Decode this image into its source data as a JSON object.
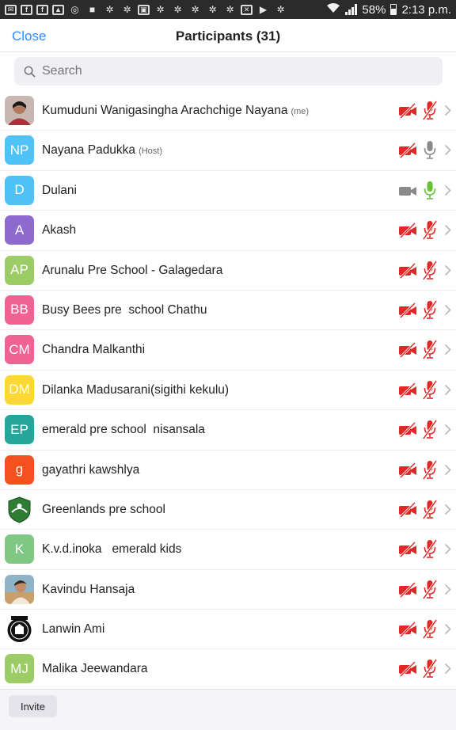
{
  "status_bar": {
    "battery": "58%",
    "time": "2:13 p.m."
  },
  "header": {
    "close_label": "Close",
    "title": "Participants (31)"
  },
  "search": {
    "placeholder": "Search"
  },
  "participants": [
    {
      "name": "Kumuduni Wanigasingha Arachchige Nayana",
      "tag": "(me)",
      "initials": "",
      "avatar_color": "#9b4d4d",
      "avatar_type": "photo",
      "video": "off",
      "audio": "muted"
    },
    {
      "name": "Nayana Padukka",
      "tag": "(Host)",
      "initials": "NP",
      "avatar_color": "#4fc3f7",
      "avatar_type": "initials",
      "video": "off",
      "audio": "available"
    },
    {
      "name": "Dulani",
      "tag": "",
      "initials": "D",
      "avatar_color": "#4fc3f7",
      "avatar_type": "initials",
      "video": "none",
      "audio": "on"
    },
    {
      "name": "Akash",
      "tag": "",
      "initials": "A",
      "avatar_color": "#8e6acf",
      "avatar_type": "initials",
      "video": "off",
      "audio": "muted"
    },
    {
      "name": "Arunalu Pre School - Galagedara",
      "tag": "",
      "initials": "AP",
      "avatar_color": "#9ccc65",
      "avatar_type": "initials",
      "video": "off",
      "audio": "muted"
    },
    {
      "name": "Busy Bees pre  school Chathu",
      "tag": "",
      "initials": "BB",
      "avatar_color": "#f06292",
      "avatar_type": "initials",
      "video": "off",
      "audio": "muted"
    },
    {
      "name": "Chandra Malkanthi",
      "tag": "",
      "initials": "CM",
      "avatar_color": "#f06292",
      "avatar_type": "initials",
      "video": "off",
      "audio": "muted"
    },
    {
      "name": "Dilanka Madusarani(sigithi kekulu)",
      "tag": "",
      "initials": "DM",
      "avatar_color": "#fdd835",
      "avatar_type": "initials",
      "video": "off",
      "audio": "muted"
    },
    {
      "name": "emerald pre school  nisansala",
      "tag": "",
      "initials": "EP",
      "avatar_color": "#26a69a",
      "avatar_type": "initials",
      "video": "off",
      "audio": "muted"
    },
    {
      "name": "gayathri kawshlya",
      "tag": "",
      "initials": "g",
      "avatar_color": "#f4511e",
      "avatar_type": "initials",
      "video": "off",
      "audio": "muted"
    },
    {
      "name": "Greenlands pre school",
      "tag": "",
      "initials": "",
      "avatar_color": "#2e7d32",
      "avatar_type": "logo-green",
      "video": "off",
      "audio": "muted"
    },
    {
      "name": "K.v.d.inoka   emerald kids",
      "tag": "",
      "initials": "K",
      "avatar_color": "#81c784",
      "avatar_type": "initials",
      "video": "off",
      "audio": "muted"
    },
    {
      "name": "Kavindu Hansaja",
      "tag": "",
      "initials": "",
      "avatar_color": "#b08d6a",
      "avatar_type": "photo2",
      "video": "off",
      "audio": "muted"
    },
    {
      "name": "Lanwin Ami",
      "tag": "",
      "initials": "",
      "avatar_color": "#111111",
      "avatar_type": "logo-dark",
      "video": "off",
      "audio": "muted"
    },
    {
      "name": "Malika Jeewandara",
      "tag": "",
      "initials": "MJ",
      "avatar_color": "#9ccc65",
      "avatar_type": "initials",
      "video": "off",
      "audio": "muted"
    }
  ],
  "footer": {
    "invite_label": "Invite"
  },
  "colors": {
    "accent": "#2d8cff",
    "muted_red": "#e02828",
    "mic_on_green": "#6abf3b",
    "inactive_gray": "#8a8a8a"
  }
}
